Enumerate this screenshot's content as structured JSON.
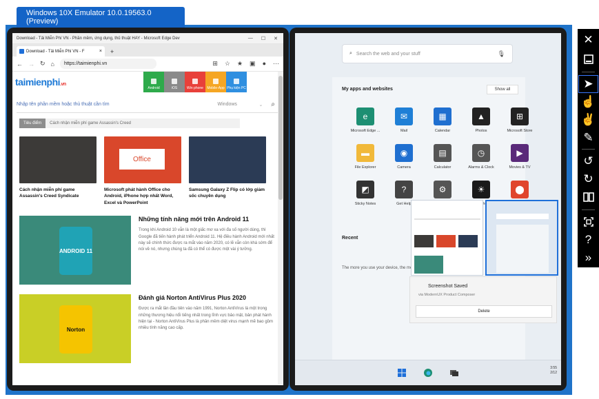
{
  "window": {
    "title": "Windows 10X Emulator 10.0.19563.0 (Preview)"
  },
  "browser": {
    "title": "Download - Tải Miễn Phí VN - Phần mềm, ứng dụng, thủ thuật HAY - Microsoft Edge Dev",
    "tab_label": "Download - Tải Miễn Phí VN - F",
    "tab_close": "×",
    "new_tab": "+",
    "url": "https://taimienphi.vn",
    "site": {
      "logo": "taimienphi",
      "logo_tld": ".vn",
      "categories": [
        {
          "label": "Android",
          "color": "#2eaa4b"
        },
        {
          "label": "iOS",
          "color": "#8a8a8a"
        },
        {
          "label": "Win phone",
          "color": "#e8403a"
        },
        {
          "label": "Mobile-App",
          "color": "#f5a623"
        },
        {
          "label": "Phụ kiện PC",
          "color": "#2f8fe0"
        }
      ],
      "search_placeholder": "Nhập tên phần mềm hoặc thủ thuật cần tìm",
      "search_select": "Windows",
      "featured_label": "Tiêu điểm",
      "featured_text": "Cách nhận miễn phí game Assassin's Creed",
      "cards": [
        {
          "title": "Cách nhận miễn phí game Assassin's Creed Syndicate",
          "color": "#3c3a38"
        },
        {
          "title": "Microsoft phát hành Office cho Android, iPhone hợp nhất Word, Excel và PowerPoint",
          "color": "#d9472b",
          "badge": "Office"
        },
        {
          "title": "Samsung Galaxy Z Flip có lớp giảm sốc chuyên dụng",
          "color": "#2b3b55"
        }
      ],
      "articles": [
        {
          "title": "Những tính năng mới trên Android 11",
          "body": "Trong khi Android 10 vẫn là một giấc mơ xa với đa số người dùng, thì Google đã tiến hành phát triển Android 11. Hệ điều hành Android mới nhất này sẽ chính thức được ra mắt vào năm 2020, có lẽ vẫn còn khá sớm để nói về nó, nhưng chúng ta đã có thể có được một vài ý tưởng.",
          "badge": "ANDROID 11"
        },
        {
          "title": "Đánh giá Norton AntiVirus Plus 2020",
          "body": "Được ra mắt lần đầu tiên vào năm 1991, Norton AntiVirus là một trong những thương hiệu nổi tiếng nhất trong lĩnh vực bảo mật, bản phát hành hiện tại - Norton AntiVirus Plus là phần mềm diệt virus mạnh mẽ bao gồm nhiều tính năng cao cấp.",
          "badge": "Norton"
        }
      ]
    }
  },
  "start": {
    "search_placeholder": "Search the web and your stuff",
    "apps_heading": "My apps and websites",
    "show_all": "Show all",
    "apps": [
      {
        "name": "Microsoft Edge ...",
        "icon": "edge-icon",
        "color": "#1d8f73"
      },
      {
        "name": "Mail",
        "icon": "mail-icon",
        "color": "#1f7fd6"
      },
      {
        "name": "Calendar",
        "icon": "calendar-icon",
        "color": "#1f6fd0"
      },
      {
        "name": "Photos",
        "icon": "photos-icon",
        "color": "#222222"
      },
      {
        "name": "Microsoft Store",
        "icon": "store-icon",
        "color": "#222222"
      },
      {
        "name": "File Explorer",
        "icon": "folder-icon",
        "color": "#f1b93a"
      },
      {
        "name": "Camera",
        "icon": "camera-icon",
        "color": "#1f6fd0"
      },
      {
        "name": "Calculator",
        "icon": "calculator-icon",
        "color": "#555555"
      },
      {
        "name": "Alarms & Clock",
        "icon": "clock-icon",
        "color": "#555555"
      },
      {
        "name": "Movies & TV",
        "icon": "movies-icon",
        "color": "#5a2a7a"
      },
      {
        "name": "Sticky Notes",
        "icon": "sticky-notes-icon",
        "color": "#333333"
      },
      {
        "name": "Get Help",
        "icon": "help-icon",
        "color": "#444444"
      },
      {
        "name": "Settings",
        "icon": "settings-icon",
        "color": "#555555"
      },
      {
        "name": "Weather",
        "icon": "weather-icon",
        "color": "#1a1a1a"
      },
      {
        "name": "Maps",
        "icon": "maps-icon",
        "color": "#e0452c"
      }
    ],
    "recent_heading": "Recent",
    "recent_text": "The more you use your device, the more..."
  },
  "toast": {
    "title": "Screenshot Saved",
    "subtitle": "via ModernUX Product Composer",
    "button": "Delete"
  },
  "taskbar": {
    "time": "3:55",
    "date": "2/12"
  }
}
